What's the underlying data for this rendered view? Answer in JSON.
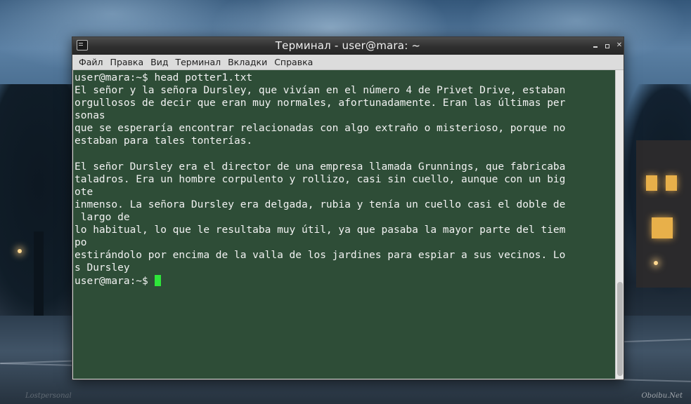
{
  "window": {
    "title": "Терминал - user@mara: ~"
  },
  "menu": {
    "items": [
      "Файл",
      "Правка",
      "Вид",
      "Терминал",
      "Вкладки",
      "Справка"
    ]
  },
  "terminal": {
    "lines": [
      "user@mara:~$ head potter1.txt",
      "El señor y la señora Dursley, que vivían en el número 4 de Privet Drive, estaban",
      "orgullosos de decir que eran muy normales, afortunadamente. Eran las últimas per",
      "sonas",
      "que se esperaría encontrar relacionadas con algo extraño o misterioso, porque no",
      "estaban para tales tonterías.",
      "",
      "El señor Dursley era el director de una empresa llamada Grunnings, que fabricaba",
      "taladros. Era un hombre corpulento y rollizo, casi sin cuello, aunque con un big",
      "ote",
      "inmenso. La señora Dursley era delgada, rubia y tenía un cuello casi el doble de",
      " largo de",
      "lo habitual, lo que le resultaba muy útil, ya que pasaba la mayor parte del tiem",
      "po",
      "estirándolo por encima de la valla de los jardines para espiar a sus vecinos. Lo",
      "s Dursley"
    ],
    "prompt": "user@mara:~$ ",
    "cursor_color": "#2ee63a",
    "background_color": "#2e4d37"
  },
  "desktop": {
    "watermark": "Oboibu.Net",
    "watermark_left": "Lostpersonal"
  }
}
